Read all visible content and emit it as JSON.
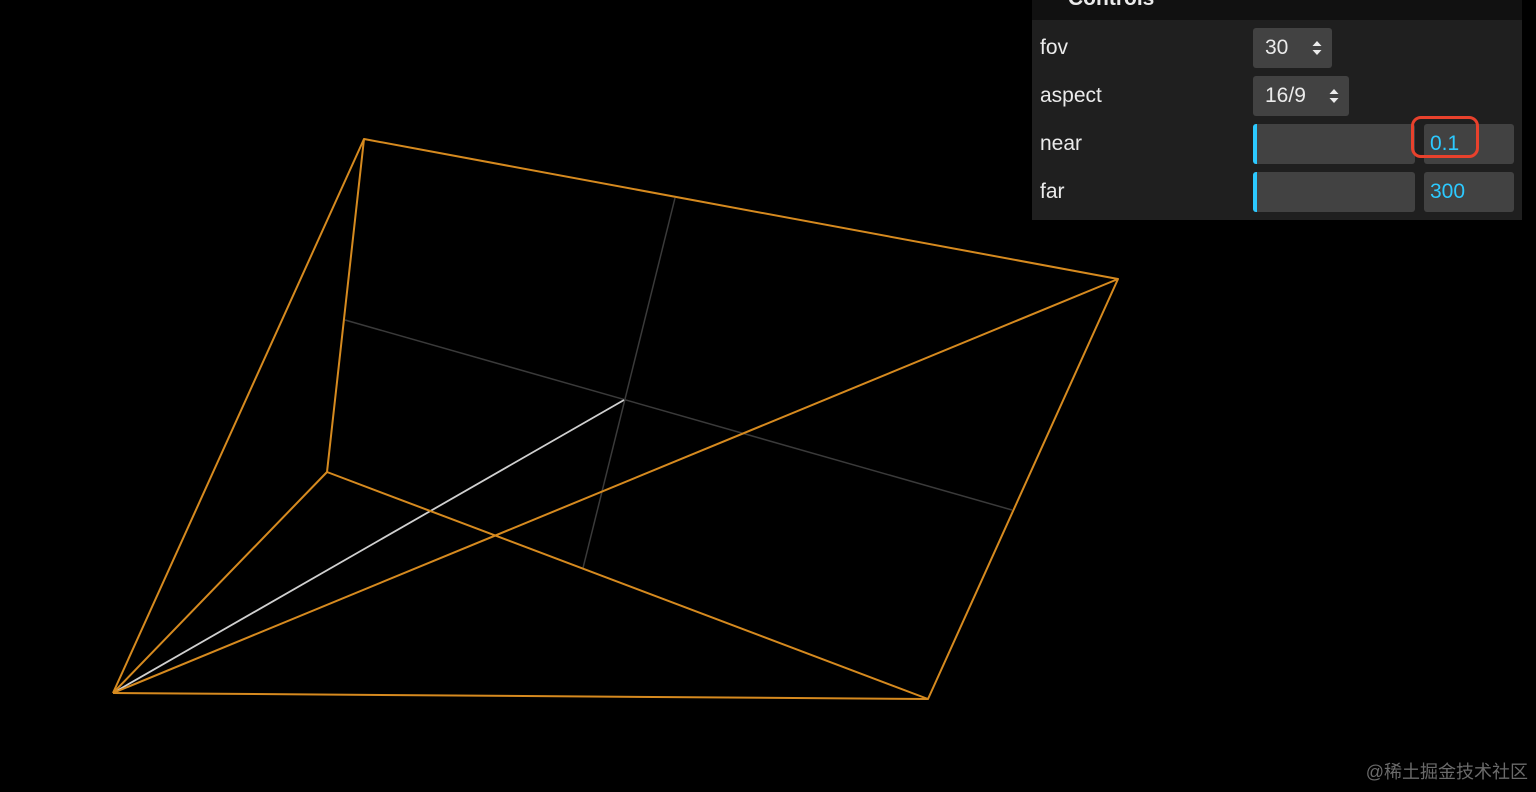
{
  "gui": {
    "title": "Controls",
    "rows": [
      {
        "label": "fov",
        "value": "30",
        "type": "select"
      },
      {
        "label": "aspect",
        "value": "16/9",
        "type": "select"
      },
      {
        "label": "near",
        "value": "0.1",
        "type": "slider",
        "fill_fraction": 0.02
      },
      {
        "label": "far",
        "value": "300",
        "type": "slider",
        "fill_fraction": 0.02
      }
    ],
    "highlighted_field": "near"
  },
  "scene": {
    "frustum_color": "#d68a1f",
    "axis_color": "#3a3a3a",
    "camera_ray_color": "#d0d0d0",
    "background": "#000000"
  },
  "colors": {
    "accent": "#2cc9ff",
    "highlight_border": "#e8412c",
    "panel_bg": "#1f1f1f",
    "control_bg": "#424242"
  },
  "watermark": "@稀土掘金技术社区"
}
